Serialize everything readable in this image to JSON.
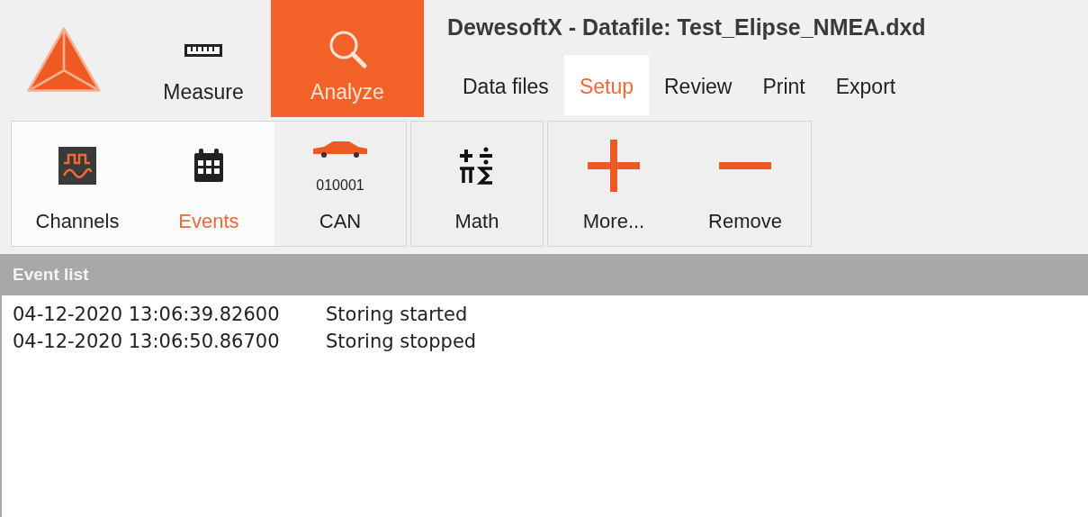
{
  "window": {
    "title": "DewesoftX - Datafile: Test_Elipse_NMEA.dxd"
  },
  "mode_tabs": [
    {
      "label": "Measure",
      "selected": false
    },
    {
      "label": "Analyze",
      "selected": true
    }
  ],
  "menu_tabs": [
    {
      "label": "Data files",
      "selected": false
    },
    {
      "label": "Setup",
      "selected": true
    },
    {
      "label": "Review",
      "selected": false
    },
    {
      "label": "Print",
      "selected": false
    },
    {
      "label": "Export",
      "selected": false
    }
  ],
  "toolbar_groups": [
    {
      "items": [
        {
          "label": "Channels",
          "selected": false,
          "hovered": true
        },
        {
          "label": "Events",
          "selected": true,
          "hovered": false
        },
        {
          "label": "CAN",
          "caption": "010001",
          "selected": false,
          "hovered": false
        }
      ]
    },
    {
      "items": [
        {
          "label": "Math",
          "selected": false,
          "hovered": false
        }
      ]
    },
    {
      "items": [
        {
          "label": "More...",
          "selected": false,
          "hovered": false
        },
        {
          "label": "Remove",
          "selected": false,
          "hovered": false
        }
      ]
    }
  ],
  "event_list": {
    "title": "Event list",
    "rows": [
      {
        "time": "04-12-2020 13:06:39.82600",
        "event": "Storing started"
      },
      {
        "time": "04-12-2020 13:06:50.86700",
        "event": "Storing stopped"
      }
    ]
  }
}
